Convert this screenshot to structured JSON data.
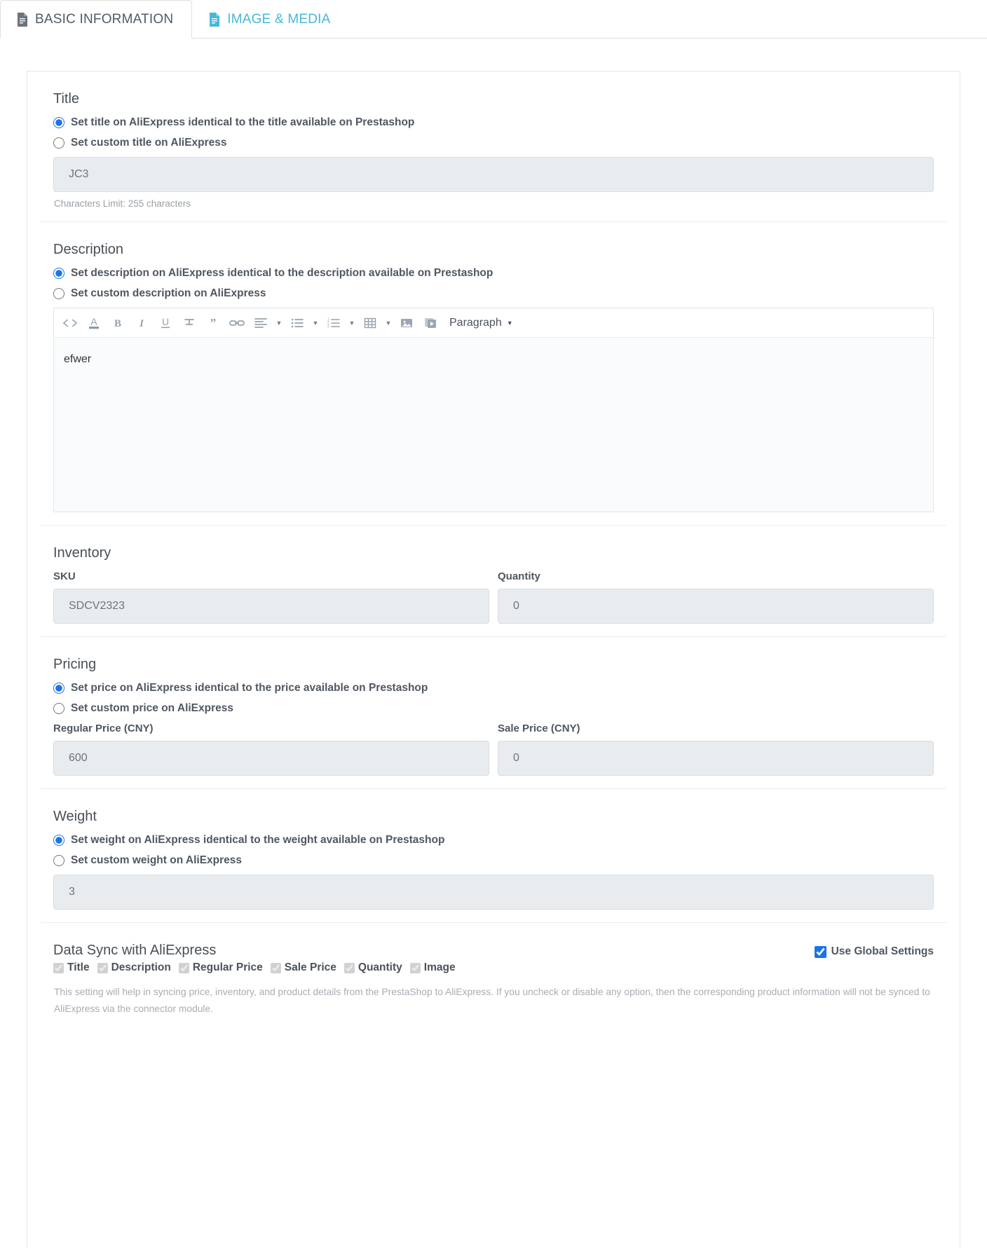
{
  "tabs": [
    {
      "label": "BASIC INFORMATION",
      "icon": "document-icon",
      "active": true
    },
    {
      "label": "IMAGE & MEDIA",
      "icon": "document-icon",
      "active": false
    }
  ],
  "colors": {
    "accent_blue": "#1a73e8",
    "tab_inactive": "#46b8da",
    "field_bg": "#e9ecef",
    "muted_text": "#9aa0a6"
  },
  "sections": {
    "title": {
      "heading": "Title",
      "option_identical": "Set title on AliExpress identical to the title available on Prestashop",
      "option_custom": "Set custom title on AliExpress",
      "input_value": "JC3",
      "hint": "Characters Limit: 255 characters"
    },
    "description": {
      "heading": "Description",
      "option_identical": "Set description on AliExpress identical to the description available on Prestashop",
      "option_custom": "Set custom description on AliExpress",
      "editor_content": "efwer",
      "toolbar": {
        "source_code": "<>",
        "font_color": "A",
        "bold": "B",
        "italic": "I",
        "underline": "U",
        "strikethrough": "S",
        "blockquote": "””",
        "link": "link",
        "align": "align-left",
        "bullet_list": "unordered-list",
        "numbered_list": "ordered-list",
        "table": "table",
        "image": "image",
        "video": "video",
        "paragraph_label": "Paragraph"
      }
    },
    "inventory": {
      "heading": "Inventory",
      "sku_label": "SKU",
      "sku_value": "SDCV2323",
      "quantity_label": "Quantity",
      "quantity_value": "0"
    },
    "pricing": {
      "heading": "Pricing",
      "option_identical": "Set price on AliExpress identical to the price available on Prestashop",
      "option_custom": "Set custom price on AliExpress",
      "regular_label": "Regular Price (CNY)",
      "regular_value": "600",
      "sale_label": "Sale Price (CNY)",
      "sale_value": "0"
    },
    "weight": {
      "heading": "Weight",
      "option_identical": "Set weight on AliExpress identical to the weight available on Prestashop",
      "option_custom": "Set custom weight on AliExpress",
      "input_value": "3"
    },
    "data_sync": {
      "heading": "Data Sync with AliExpress",
      "use_global_label": "Use Global Settings",
      "use_global_checked": true,
      "items": [
        {
          "label": "Title",
          "checked": true,
          "disabled": true
        },
        {
          "label": "Description",
          "checked": true,
          "disabled": true
        },
        {
          "label": "Regular Price",
          "checked": true,
          "disabled": true
        },
        {
          "label": "Sale Price",
          "checked": true,
          "disabled": true
        },
        {
          "label": "Quantity",
          "checked": true,
          "disabled": true
        },
        {
          "label": "Image",
          "checked": true,
          "disabled": true
        }
      ],
      "note": "This setting will help in syncing price, inventory, and product details from the PrestaShop to AliExpress. If you uncheck or disable any option, then the corresponding product information will not be synced to AliExpress via the connector module."
    }
  }
}
